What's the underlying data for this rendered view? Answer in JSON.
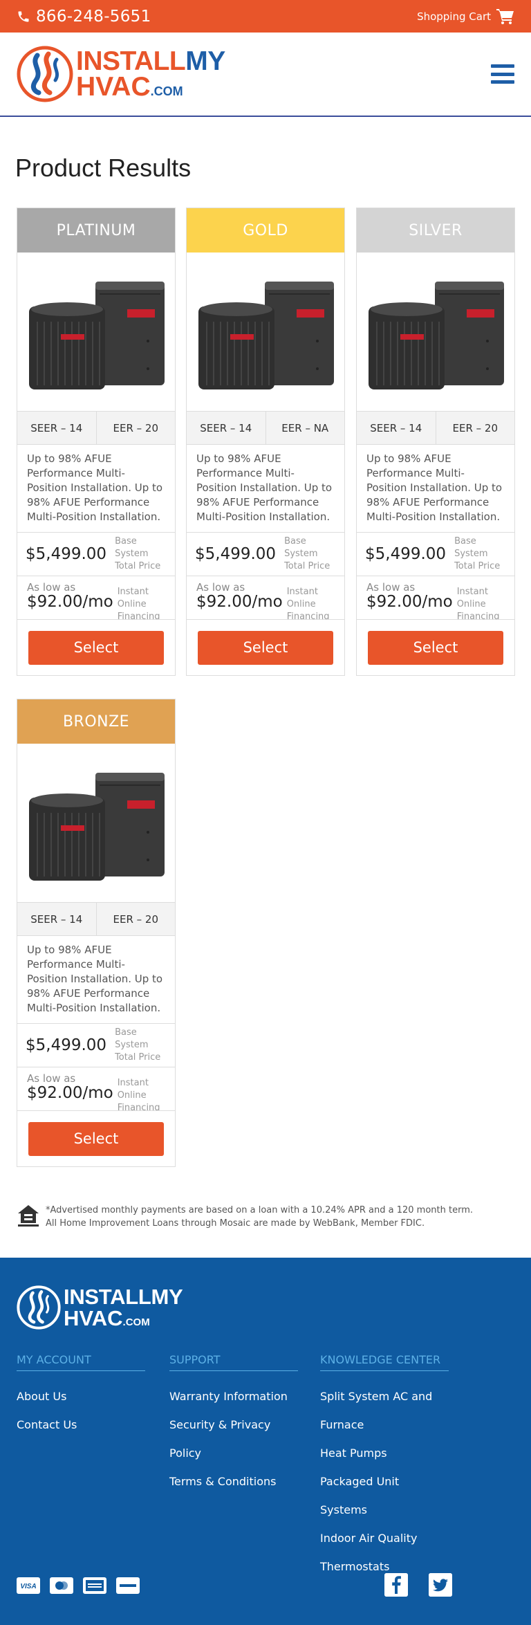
{
  "topbar": {
    "phone": "866-248-5651",
    "cart_label": "Shopping Cart"
  },
  "brand": {
    "line1_orange": "INSTALL",
    "line1_blue": "MY",
    "line2": "HVAC",
    "line2_suffix": ".COM"
  },
  "page_title": "Product Results",
  "products": [
    {
      "tier": "PLATINUM",
      "seer": "SEER – 14",
      "eer": "EER – 20",
      "description": "Up to 98% AFUE Performance Multi-Position Installation. Up to 98% AFUE Performance Multi-Position Installation.",
      "price": "$5,499.00",
      "price_note": "Base System Total Price",
      "as_low_as": "As low as",
      "monthly": "$92.00/mo",
      "monthly_note": "Instant Online Financing",
      "button": "Select"
    },
    {
      "tier": "GOLD",
      "seer": "SEER – 14",
      "eer": "EER – NA",
      "description": "Up to 98% AFUE Performance Multi-Position Installation. Up to 98% AFUE Performance Multi-Position Installation.",
      "price": "$5,499.00",
      "price_note": "Base System Total Price",
      "as_low_as": "As low as",
      "monthly": "$92.00/mo",
      "monthly_note": "Instant Online Financing",
      "button": "Select"
    },
    {
      "tier": "SILVER",
      "seer": "SEER – 14",
      "eer": "EER – 20",
      "description": "Up to 98% AFUE Performance Multi-Position Installation. Up to 98% AFUE Performance Multi-Position Installation.",
      "price": "$5,499.00",
      "price_note": "Base System Total Price",
      "as_low_as": "As low as",
      "monthly": "$92.00/mo",
      "monthly_note": "Instant Online Financing",
      "button": "Select"
    },
    {
      "tier": "BRONZE",
      "seer": "SEER – 14",
      "eer": "EER – 20",
      "description": "Up to 98% AFUE Performance Multi-Position Installation. Up to 98% AFUE Performance Multi-Position Installation.",
      "price": "$5,499.00",
      "price_note": "Base System Total Price",
      "as_low_as": "As low as",
      "monthly": "$92.00/mo",
      "monthly_note": "Instant Online Financing",
      "button": "Select"
    }
  ],
  "disclaimer": {
    "line1": "*Advertised monthly payments are based on a loan with a 10.24% APR and a 120 month term.",
    "line2": "All Home Improvement Loans through Mosaic are made by WebBank, Member FDIC."
  },
  "footer": {
    "brand": {
      "line1": "INSTALLMY",
      "line2": "HVAC",
      "line2_suffix": ".COM"
    },
    "columns": [
      {
        "heading": "MY ACCOUNT",
        "links": [
          "About Us",
          "Contact Us"
        ]
      },
      {
        "heading": "SUPPORT",
        "links": [
          "Warranty Information",
          "Security & Privacy Policy",
          "Terms & Conditions"
        ]
      },
      {
        "heading": "KNOWLEDGE CENTER",
        "links": [
          "Split System AC and Furnace",
          "Heat Pumps",
          "Packaged Unit Systems",
          "Indoor Air Quality",
          "Thermostats"
        ]
      }
    ],
    "payment_icons": [
      "visa-icon",
      "mastercard-icon",
      "amex-icon",
      "discover-icon"
    ],
    "social_icons": [
      "facebook-icon",
      "twitter-icon"
    ]
  },
  "colors": {
    "accent": "#e8552a",
    "brand_blue": "#1e5ea7",
    "footer_bg": "#0f5aa0",
    "platinum": "#a8a8a8",
    "gold": "#fcd34d",
    "silver": "#d4d4d4",
    "bronze": "#e0a253"
  }
}
